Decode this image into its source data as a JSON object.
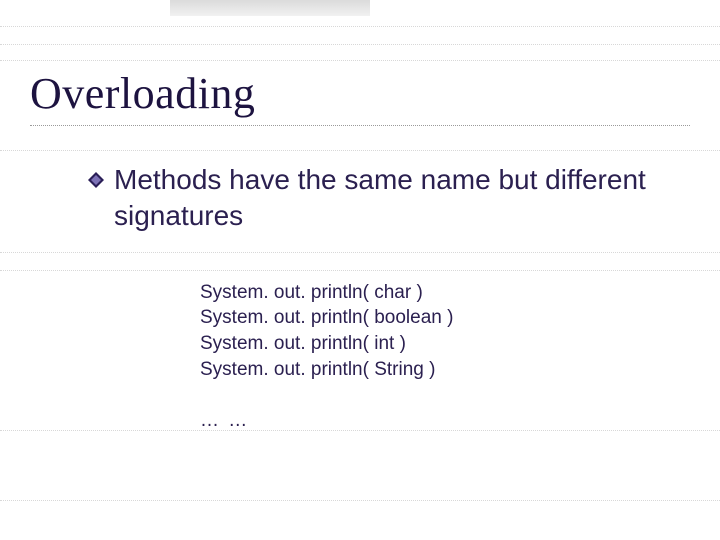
{
  "slide": {
    "title": "Overloading",
    "bullet": "Methods have the same name but different signatures",
    "code_lines": [
      "System. out. println( char )",
      "System. out. println( boolean )",
      "System. out. println( int )",
      "System. out. println( String )"
    ],
    "ellipsis": "… …"
  },
  "icons": {
    "bullet": "diamond-bullet-icon"
  },
  "colors": {
    "text": "#2b2050",
    "accent_dark": "#2a1e57",
    "accent_mid": "#6b5fa3"
  }
}
